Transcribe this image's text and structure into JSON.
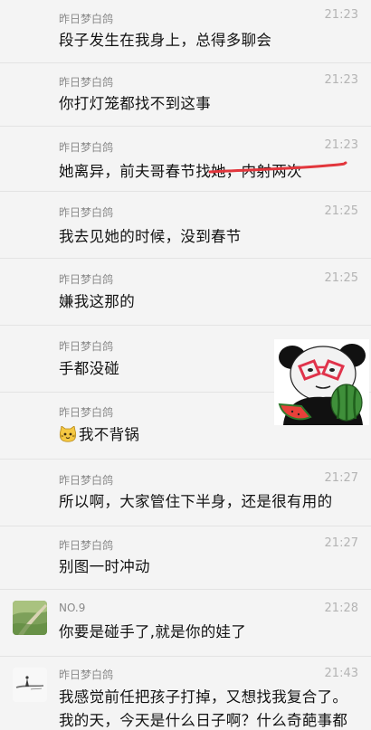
{
  "messages": [
    {
      "name": "昨日梦白鸽",
      "time": "21:23",
      "text": "段子发生在我身上，总得多聊会"
    },
    {
      "name": "昨日梦白鸽",
      "time": "21:23",
      "text": "你打灯笼都找不到这事"
    },
    {
      "name": "昨日梦白鸽",
      "time": "21:23",
      "text": "她离异，前夫哥春节找她，内射两次"
    },
    {
      "name": "昨日梦白鸽",
      "time": "21:25",
      "text": "我去见她的时候，没到春节"
    },
    {
      "name": "昨日梦白鸽",
      "time": "21:25",
      "text": "嫌我这那的"
    },
    {
      "name": "昨日梦白鸽",
      "time": "",
      "text": "手都没碰"
    },
    {
      "name": "昨日梦白鸽",
      "time": "",
      "text": "我不背锅"
    },
    {
      "name": "昨日梦白鸽",
      "time": "21:27",
      "text": "所以啊，大家管住下半身，还是很有用的"
    },
    {
      "name": "昨日梦白鸽",
      "time": "21:27",
      "text": "别图一时冲动"
    },
    {
      "name": "NO.9",
      "time": "21:28",
      "text": "你要是碰手了,就是你的娃了"
    },
    {
      "name": "昨日梦白鸽",
      "time": "21:43",
      "text": "我感觉前任把孩子打掉，又想找我复合了。",
      "text2": "我的天，今天是什么日子啊？什么奇葩事都"
    }
  ],
  "colors": {
    "background": "#f4f4f4",
    "name": "#8a8a8a",
    "time": "#b4b4b4",
    "strike": "#e2363c"
  },
  "icons": {
    "inline_emoji": "cat-face-emoji",
    "sticker": "panda-glasses-watermelon-sticker"
  }
}
